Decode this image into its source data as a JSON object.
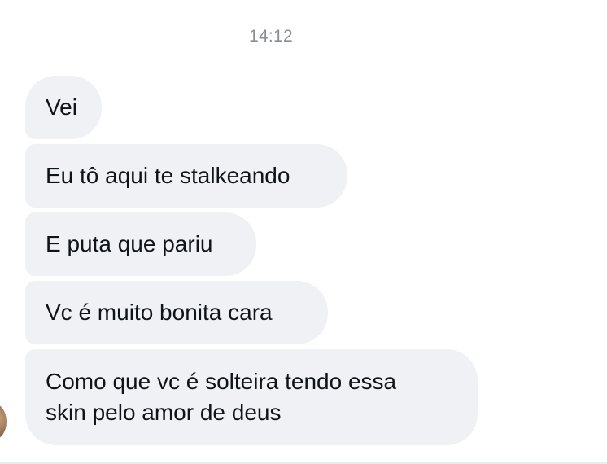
{
  "conversation": {
    "timestamp": "14:12",
    "messages": [
      {
        "text": "Vei"
      },
      {
        "text": "Eu tô aqui te stalkeando"
      },
      {
        "text": "E puta que pariu"
      },
      {
        "text": "Vc é muito bonita cara"
      },
      {
        "lines": [
          "Como que vc é solteira tendo essa",
          "skin pelo amor de deus"
        ]
      }
    ],
    "bubble_color": "#eff1f4",
    "text_color": "#0f1419",
    "timestamp_color": "#8a8d91"
  }
}
